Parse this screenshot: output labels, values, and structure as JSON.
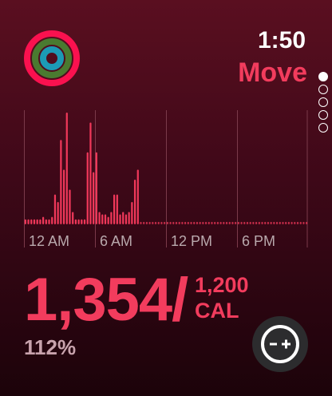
{
  "status": {
    "time": "1:50"
  },
  "header": {
    "ring_name": "Move"
  },
  "activity_rings": {
    "icon": "activity-rings-icon",
    "move_color": "#fa114f",
    "exercise_color": "#3fd45e",
    "stand_color": "#1ec8e6"
  },
  "colors": {
    "accent": "#f23c5d",
    "bar_color": "#f0385a",
    "axis_label": "#b9a9ad",
    "grid": "#7a3a4a",
    "percent": "#c8a3ad"
  },
  "pagination": {
    "count": 5,
    "active_index": 0
  },
  "chart_data": {
    "type": "bar",
    "unit": "CAL",
    "x_tick_labels": [
      "12 AM",
      "6 AM",
      "12 PM",
      "6 PM"
    ],
    "hourly_segments_per_hour": 4,
    "values": [
      2,
      2,
      2,
      2,
      2,
      2,
      3,
      2,
      2,
      3,
      12,
      9,
      34,
      22,
      45,
      14,
      5,
      2,
      2,
      2,
      2,
      29,
      41,
      21,
      29,
      5,
      4,
      4,
      3,
      5,
      12,
      12,
      4,
      5,
      4,
      5,
      9,
      18,
      22,
      1,
      1,
      1,
      1,
      1,
      1,
      1,
      1,
      1,
      1,
      1,
      1,
      1,
      1,
      1,
      1,
      1,
      1,
      1,
      1,
      1,
      1,
      1,
      1,
      1,
      1,
      1,
      1,
      1,
      1,
      1,
      1,
      1,
      1,
      1,
      1,
      1,
      1,
      1,
      1,
      1,
      1,
      1,
      1,
      1,
      1,
      1,
      1,
      1,
      1,
      1,
      1,
      1,
      1,
      1,
      1,
      1
    ],
    "ylim": [
      0,
      45
    ]
  },
  "summary": {
    "total": "1,354/",
    "goal": "1,200",
    "unit": "CAL",
    "percent": "112%"
  },
  "controls": {
    "adjust_icon": "minus-plus-icon"
  }
}
